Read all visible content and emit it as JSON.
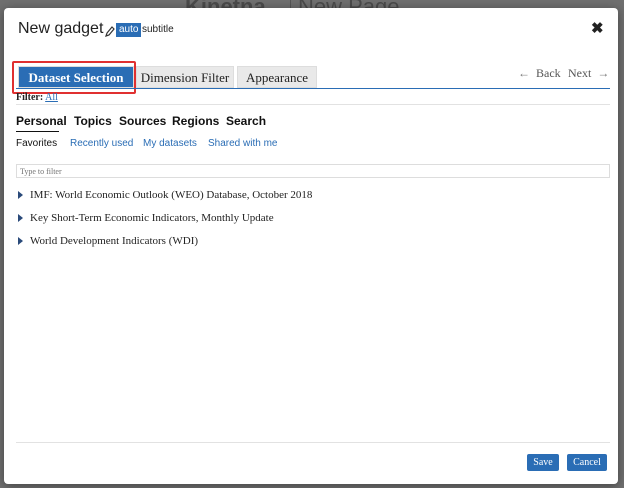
{
  "background": {
    "left_text": "Kinetna",
    "right_text": "New Page"
  },
  "dialog": {
    "title": "New gadget",
    "badge": "auto",
    "subtitle": "subtitle",
    "close": "✖"
  },
  "tabs": [
    {
      "label": "Dataset Selection",
      "active": true
    },
    {
      "label": "Dimension Filter",
      "active": false
    },
    {
      "label": "Appearance",
      "active": false
    }
  ],
  "nav": {
    "back_arrow": "←",
    "back": "Back",
    "next": "Next",
    "next_arrow": "→"
  },
  "filter": {
    "label": "Filter:",
    "value": "All"
  },
  "categories": [
    "Personal",
    "Topics",
    "Sources",
    "Regions",
    "Search"
  ],
  "subcategories": [
    "Favorites",
    "Recently used",
    "My datasets",
    "Shared with me"
  ],
  "search": {
    "placeholder": "Type to filter"
  },
  "datasets": [
    "IMF: World Economic Outlook (WEO) Database, October 2018",
    "Key Short-Term Economic Indicators, Monthly Update",
    "World Development Indicators (WDI)"
  ],
  "footer": {
    "save": "Save",
    "cancel": "Cancel"
  },
  "colors": {
    "accent": "#2a6db5",
    "highlight": "#e03030"
  }
}
